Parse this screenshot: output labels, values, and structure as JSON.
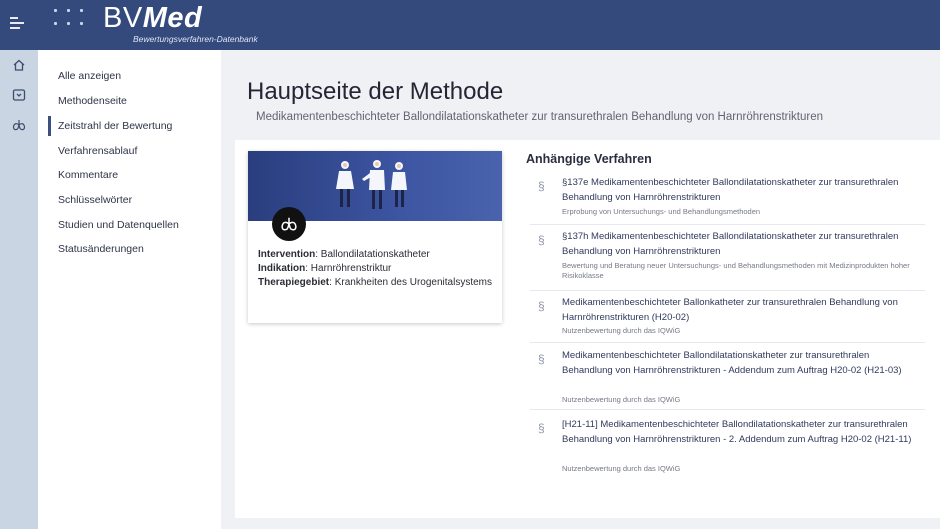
{
  "brand": {
    "name_part1": "BV",
    "name_part2": "Med",
    "subtitle": "Bewertungsverfahren-Datenbank"
  },
  "rail": {
    "icons": [
      "home-icon",
      "inbox-icon",
      "lungs-icon"
    ]
  },
  "sidebar": {
    "items": [
      {
        "label": "Alle anzeigen"
      },
      {
        "label": "Methodenseite"
      },
      {
        "label": "Zeitstrahl der Bewertung"
      },
      {
        "label": "Verfahrensablauf"
      },
      {
        "label": "Kommentare"
      },
      {
        "label": "Schlüsselwörter"
      },
      {
        "label": "Studien und Datenquellen"
      },
      {
        "label": "Statusänderungen"
      }
    ]
  },
  "page": {
    "title": "Hauptseite der Methode",
    "subtitle": "Medikamentenbeschichteter Ballondilatationskatheter zur transurethralen Behandlung von Harnröhrenstrikturen"
  },
  "method_card": {
    "intervention_label": "Intervention",
    "intervention_value": "Ballondilatationskatheter",
    "indication_label": "Indikation",
    "indication_value": "Harnröhrenstriktur",
    "therapy_label": "Therapiegebiet",
    "therapy_value": "Krankheiten des Urogenitalsystems"
  },
  "pending": {
    "title": "Anhängige Verfahren",
    "section_symbol": "§",
    "entries": [
      {
        "title": "§137e Medikamentenbeschichteter Ballondilatationskatheter zur transurethralen Behandlung von Harnröhrenstrikturen",
        "desc": "Erprobung von Untersuchungs- und Behandlungsmethoden"
      },
      {
        "title": "§137h Medikamentenbeschichteter Ballondilatationskatheter zur transurethralen Behandlung von Harnröhrenstrikturen",
        "desc": "Bewertung und Beratung neuer Untersuchungs- und Behandlungsmethoden mit Medizinprodukten hoher Risikoklasse"
      },
      {
        "title": "Medikamentenbeschichteter Ballonkatheter zur transurethralen Behandlung von Harnröhrenstrikturen (H20-02)",
        "desc": "Nutzenbewertung durch das IQWiG"
      },
      {
        "title": "Medikamentenbeschichteter Ballondilatationskatheter zur transurethralen Behandlung von Harnröhrenstrikturen - Addendum zum Auftrag H20-02 (H21-03)",
        "desc": "Nutzenbewertung durch das IQWiG"
      },
      {
        "title": "[H21-11] Medikamentenbeschichteter Ballondilatationskatheter zur transurethralen Behandlung von Harnröhrenstrikturen - 2. Addendum zum Auftrag H20-02 (H21-11)",
        "desc": "Nutzenbewertung durch das IQWiG"
      }
    ]
  },
  "colors": {
    "topbar": "#344a7d",
    "rail": "#c9d5e2",
    "accent": "#3b4f80"
  }
}
